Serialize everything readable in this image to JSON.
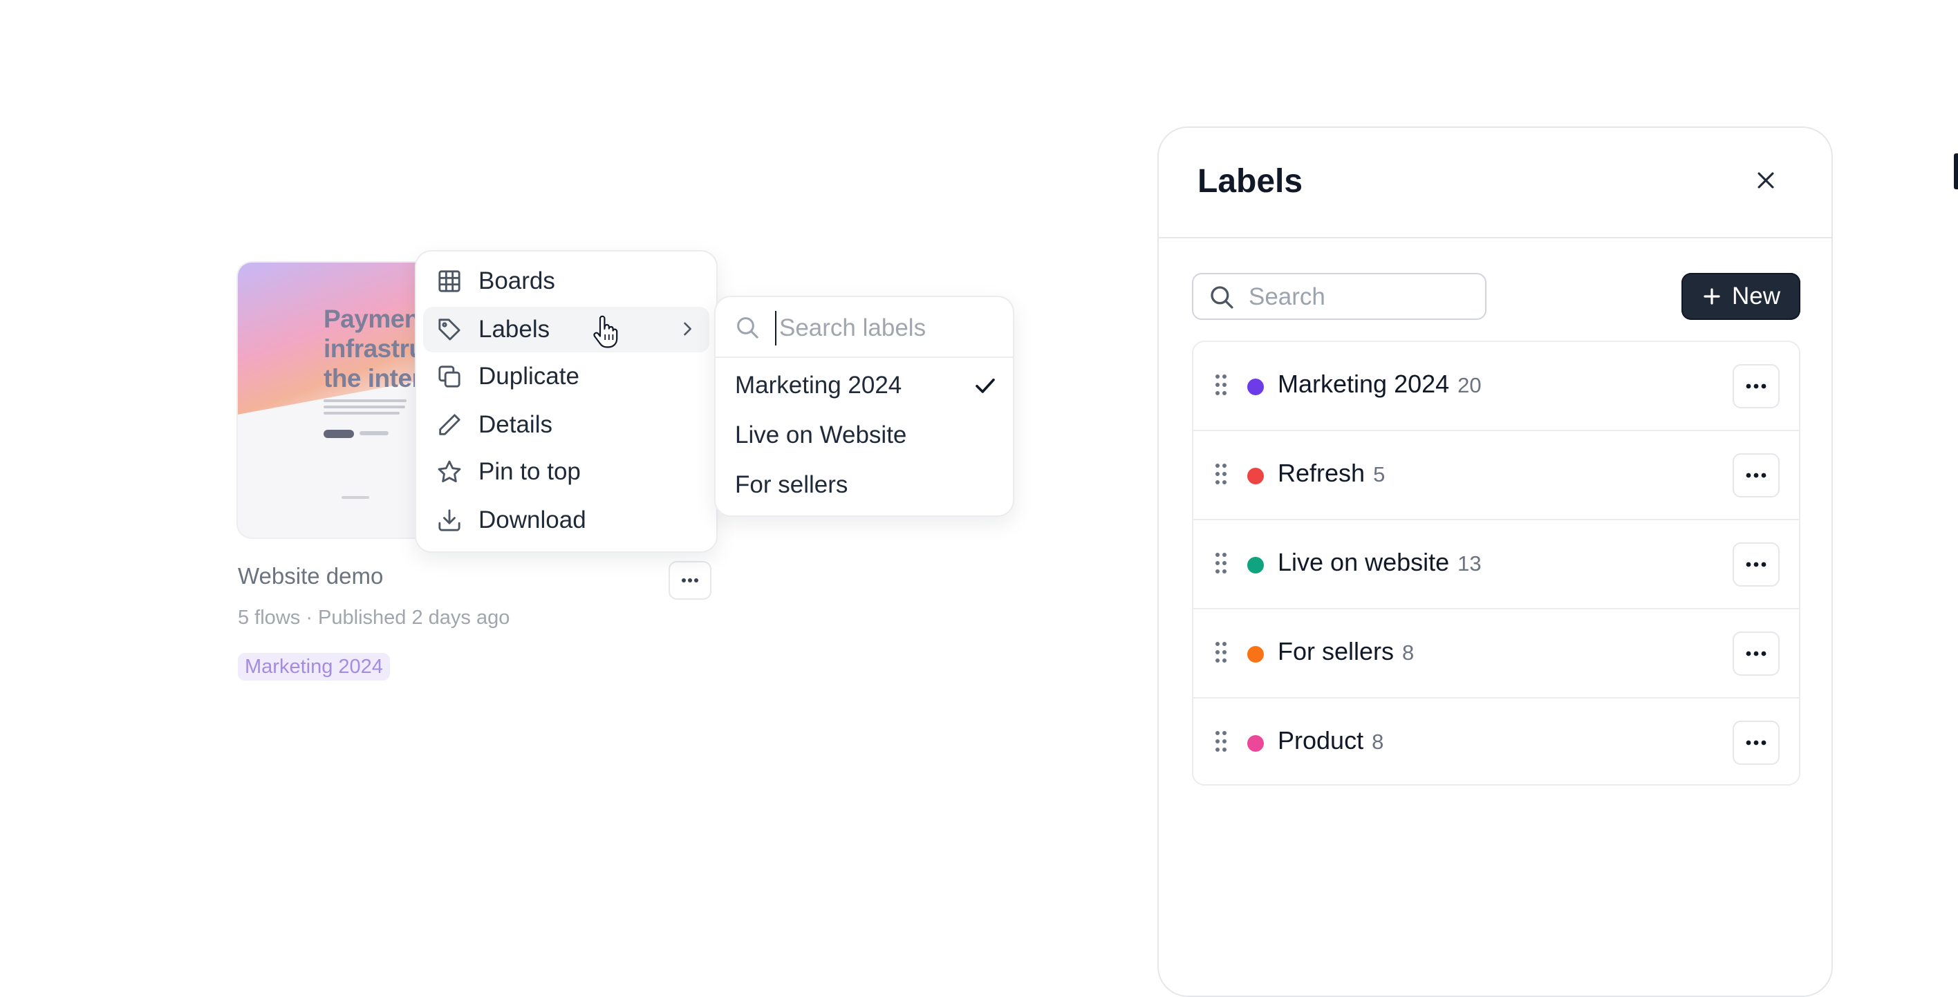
{
  "card": {
    "thumbnail_headline": "Payments infrastructure for the internet",
    "title": "Website demo",
    "meta": "5 flows · Published 2 days ago",
    "tag": "Marketing 2024"
  },
  "context_menu": {
    "items": [
      {
        "label": "Boards",
        "icon": "grid-icon"
      },
      {
        "label": "Labels",
        "icon": "tag-icon",
        "has_submenu": true,
        "active": true
      },
      {
        "label": "Duplicate",
        "icon": "copy-icon"
      },
      {
        "label": "Details",
        "icon": "pencil-icon"
      },
      {
        "label": "Pin to top",
        "icon": "star-icon"
      },
      {
        "label": "Download",
        "icon": "download-icon"
      }
    ]
  },
  "labels_submenu": {
    "search_placeholder": "Search labels",
    "items": [
      {
        "label": "Marketing 2024",
        "checked": true
      },
      {
        "label": "Live on Website",
        "checked": false
      },
      {
        "label": "For sellers",
        "checked": false
      }
    ]
  },
  "labels_panel": {
    "title": "Labels",
    "search_placeholder": "Search",
    "new_button": "New",
    "labels": [
      {
        "name": "Marketing 2024",
        "count": "20",
        "color": "#6d3ce8"
      },
      {
        "name": "Refresh",
        "count": "5",
        "color": "#ef4444"
      },
      {
        "name": "Live on website",
        "count": "13",
        "color": "#10a37f"
      },
      {
        "name": "For sellers",
        "count": "8",
        "color": "#f97316"
      },
      {
        "name": "Product",
        "count": "8",
        "color": "#ec4899"
      }
    ]
  }
}
